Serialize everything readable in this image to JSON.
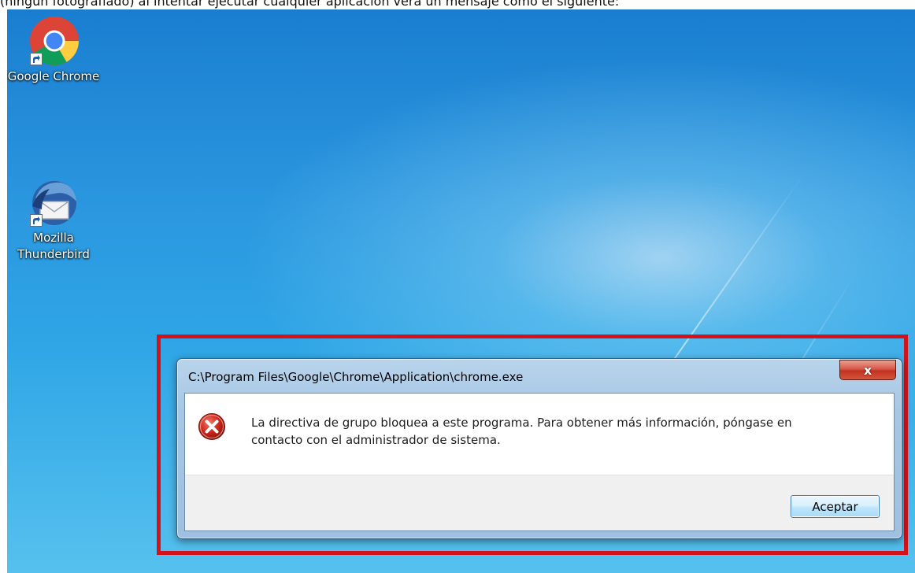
{
  "caption": "(ningún fotografiado) al intentar ejecutar cualquier aplicación verá un mensaje como el siguiente:",
  "desktop": {
    "icons": [
      {
        "label_line1": "Google Chrome",
        "label_line2": "",
        "icon": "chrome-icon"
      },
      {
        "label_line1": "Mozilla",
        "label_line2": "Thunderbird",
        "icon": "thunderbird-icon"
      }
    ]
  },
  "dialog": {
    "title": "C:\\Program Files\\Google\\Chrome\\Application\\chrome.exe",
    "close_label": "x",
    "message_line1": "La directiva de grupo bloquea a este programa. Para obtener más información, póngase en",
    "message_line2": "contacto con el administrador de sistema.",
    "ok_label": "Aceptar",
    "icon": "error-icon"
  },
  "colors": {
    "highlight_frame": "#d3121b",
    "desktop_blue": "#2b97df"
  }
}
